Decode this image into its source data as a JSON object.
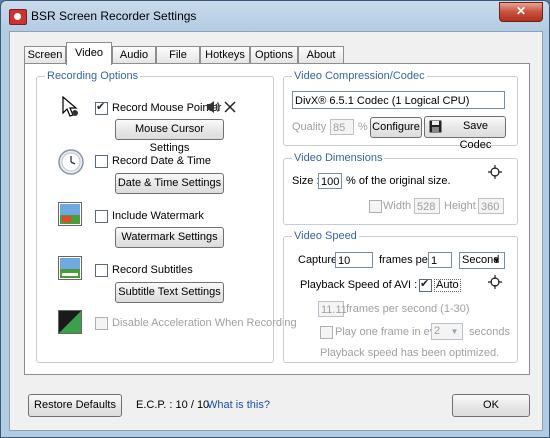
{
  "window": {
    "title": "BSR Screen Recorder Settings",
    "close_icon": "close-icon"
  },
  "tabs": [
    {
      "label": "Screen"
    },
    {
      "label": "Video"
    },
    {
      "label": "Audio"
    },
    {
      "label": "File"
    },
    {
      "label": "Hotkeys"
    },
    {
      "label": "Options"
    },
    {
      "label": "About"
    }
  ],
  "active_tab": "Video",
  "recording_options": {
    "legend": "Recording Options",
    "record_mouse_pointer": {
      "label": "Record Mouse Pointer",
      "checked": true,
      "button": "Mouse Cursor Settings"
    },
    "record_date_time": {
      "label": "Record Date & Time",
      "checked": false,
      "button": "Date & Time Settings"
    },
    "include_watermark": {
      "label": "Include Watermark",
      "checked": false,
      "button": "Watermark Settings"
    },
    "record_subtitles": {
      "label": "Record Subtitles",
      "checked": false,
      "button": "Subtitle Text Settings"
    },
    "disable_acceleration": {
      "label": "Disable Acceleration When Recording",
      "checked": false,
      "enabled": false
    }
  },
  "video_codec": {
    "legend": "Video Compression/Codec",
    "codec_value": "DivX® 6.5.1 Codec (1 Logical CPU)",
    "quality_label": "Quality :",
    "quality_value": "85",
    "quality_unit": "%",
    "configure_button": "Configure",
    "save_codec_button": "Save Codec"
  },
  "video_dimensions": {
    "legend": "Video Dimensions",
    "size_label": "Size :",
    "size_value": "100",
    "size_suffix": "% of the original size.",
    "width_label": "Width :",
    "width_value": "528",
    "height_label": "Height :",
    "height_value": "360"
  },
  "video_speed": {
    "legend": "Video Speed",
    "capture_label": "Capture",
    "capture_value": "10",
    "frames_per_label": "frames per",
    "frames_per_value": "1",
    "unit_value": "Second",
    "playback_label": "Playback Speed of AVI :",
    "auto_label": "Auto",
    "auto_checked": true,
    "fps_value": "11.11",
    "fps_label": "frames per second (1-30)",
    "play_one_frame_label": "Play one frame in every",
    "play_one_frame_value": "2",
    "seconds_label": "seconds",
    "status": "Playback speed has been optimized."
  },
  "bottom": {
    "restore_defaults": "Restore Defaults",
    "ecp_label": "E.C.P. : 10 / 10",
    "what_is_this": "What is this?",
    "ok": "OK"
  },
  "colors": {
    "legend_blue": "#3564a6",
    "title_bar": "#b3cbe3",
    "close_red": "#c7523d"
  }
}
